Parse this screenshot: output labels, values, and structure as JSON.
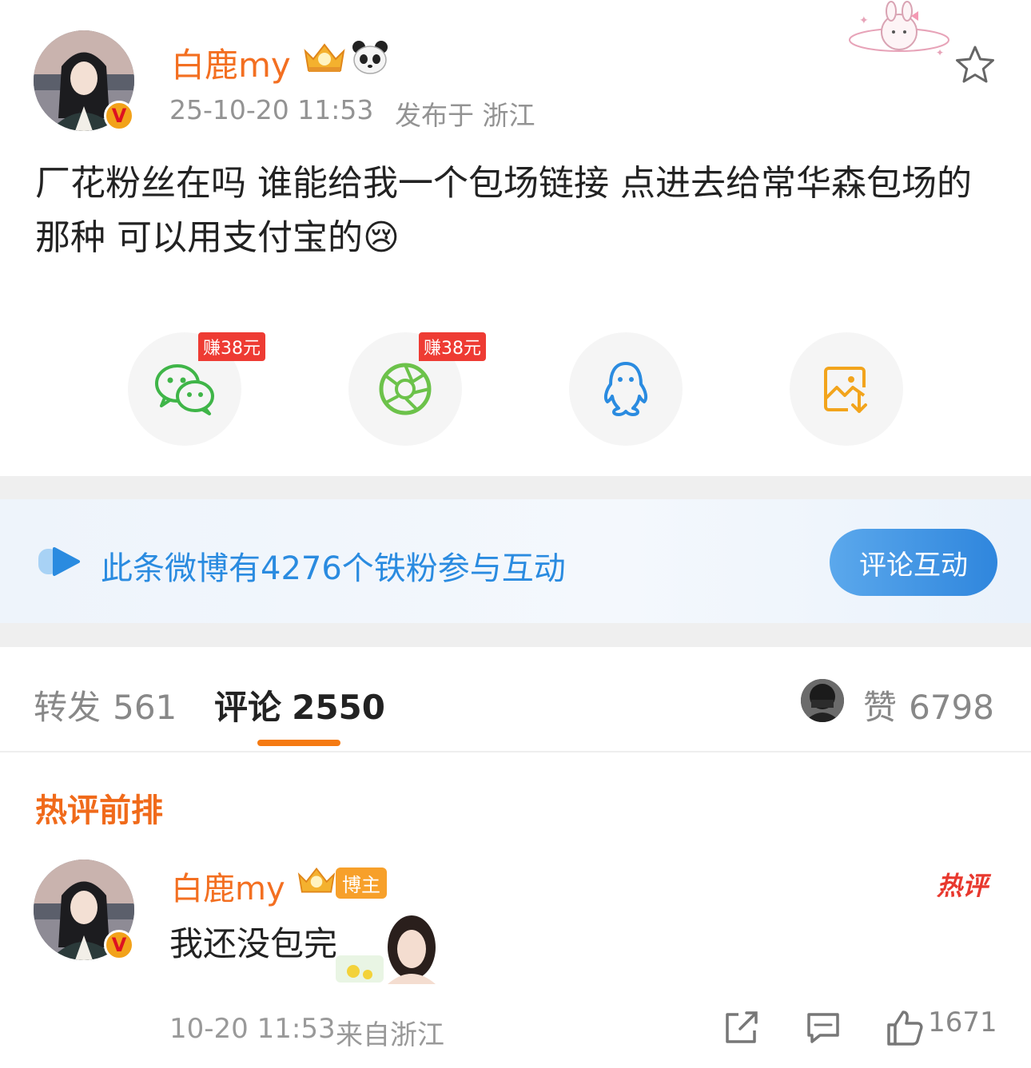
{
  "post": {
    "author": "白鹿my",
    "timestamp": "25-10-20 11:53",
    "location": "发布于 浙江",
    "text": "厂花粉丝在吗 谁能给我一个包场链接 点进去给常华森包场的那种 可以用支付宝的",
    "emoji": "😢"
  },
  "share": {
    "earn_badge_1": "赚38元",
    "earn_badge_2": "赚38元"
  },
  "fans_banner": {
    "text": "此条微博有4276个铁粉参与互动",
    "button": "评论互动"
  },
  "tabs": {
    "repost_label": "转发",
    "repost_count": "561",
    "comment_label": "评论",
    "comment_count": "2550",
    "like_label": "赞",
    "like_count": "6798"
  },
  "hot_section": {
    "title": "热评前排"
  },
  "comment": {
    "author": "白鹿my",
    "badge": "博主",
    "text": "我还没包完",
    "hot_tag": "热评",
    "timestamp": "10-20 11:53",
    "location": "来自浙江",
    "like_count": "1671"
  },
  "colors": {
    "accent_orange": "#f36f21",
    "link_blue": "#2a8be0",
    "earn_red": "#ee3b33"
  }
}
